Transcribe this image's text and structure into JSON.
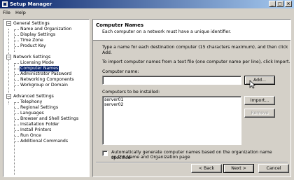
{
  "window": {
    "title": "Setup Manager"
  },
  "menu": [
    "File",
    "Help"
  ],
  "tree": {
    "groups": [
      {
        "label": "General Settings",
        "expander": "−",
        "children": [
          "Name and Organization",
          "Display Settings",
          "Time Zone",
          "Product Key"
        ]
      },
      {
        "label": "Network Settings",
        "expander": "−",
        "children": [
          "Licensing Mode",
          "Computer Names",
          "Administrator Password",
          "Networking Components",
          "Workgroup or Domain"
        ]
      },
      {
        "label": "Advanced Settings",
        "expander": "−",
        "children": [
          "Telephony",
          "Regional Settings",
          "Languages",
          "Browser and Shell Settings",
          "Installation Folder",
          "Install Printers",
          "Run Once",
          "Additional Commands"
        ]
      }
    ],
    "selected": "Computer Names"
  },
  "page": {
    "title": "Computer Names",
    "description": "Each computer on a network must have a unique identifier.",
    "instructions1": "Type a name for each destination computer (15 characters maximum), and then click",
    "instructions1b": "Add.",
    "instructions2": "To import computer names from a text file (one computer name per line), click Import.",
    "name_label": "Computer name:",
    "name_value": "",
    "list_label": "Computers to be installed:",
    "computers": [
      "server01",
      "server02"
    ],
    "buttons": {
      "add": "Add...",
      "import": "Import...",
      "remove": "Remove"
    },
    "checkbox_label_line1": "Automatically generate computer names based on the organization name specified",
    "checkbox_label_line2": "on the Name and Organization page",
    "checkbox_checked": false
  },
  "footer": {
    "back": "< Back",
    "next": "Next >",
    "cancel": "Cancel"
  }
}
